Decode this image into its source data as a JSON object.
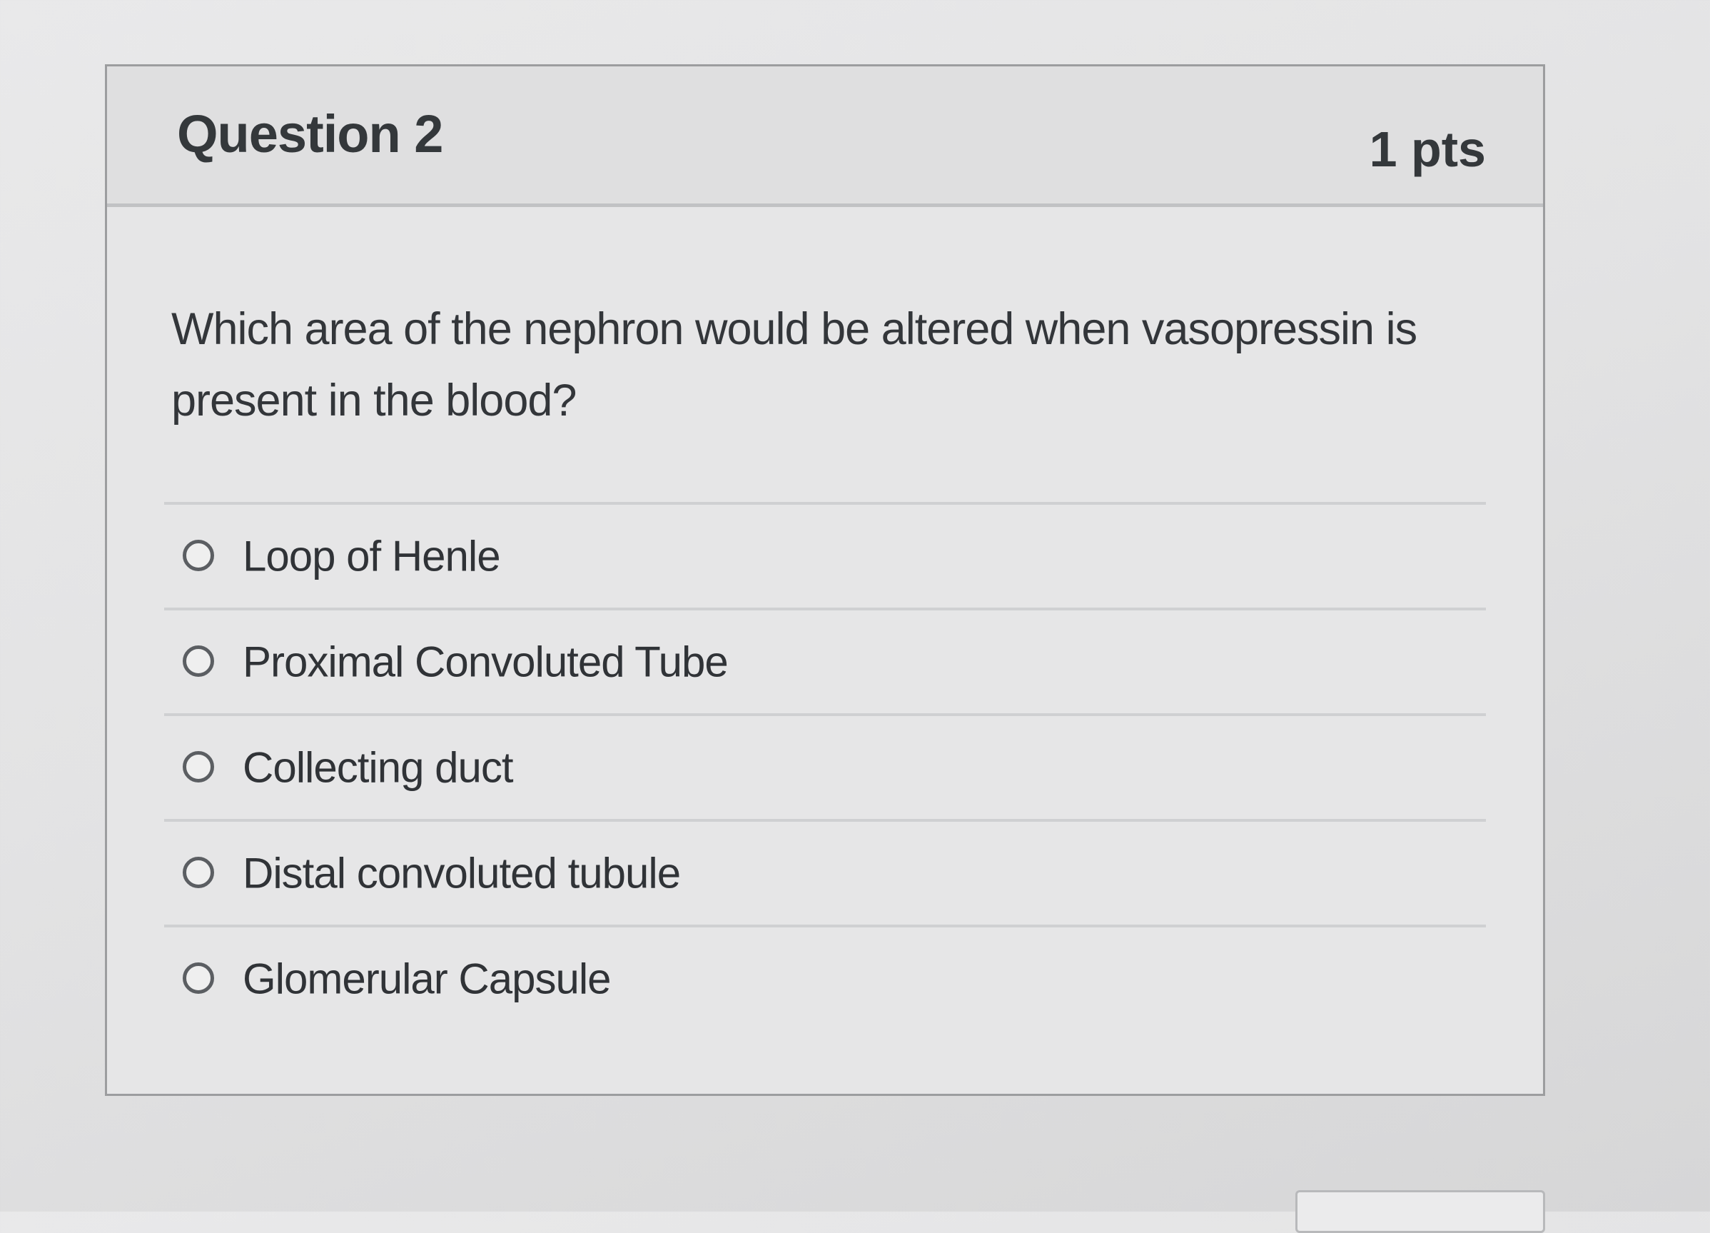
{
  "question": {
    "title": "Question 2",
    "points": "1 pts",
    "text": "Which area of the nephron would be altered when vasopressin is present in the blood?",
    "answers": [
      {
        "label": "Loop of Henle",
        "selected": false
      },
      {
        "label": "Proximal Convoluted Tube",
        "selected": false
      },
      {
        "label": "Collecting duct",
        "selected": false
      },
      {
        "label": "Distal convoluted tubule",
        "selected": false
      },
      {
        "label": "Glomerular Capsule",
        "selected": false
      }
    ]
  }
}
